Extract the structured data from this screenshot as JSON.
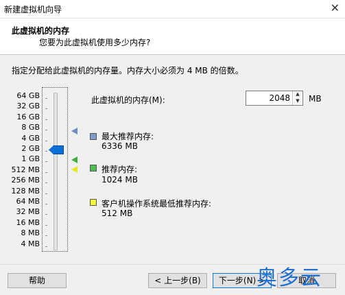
{
  "window": {
    "title": "新建虚拟机向导",
    "close_glyph": "✕"
  },
  "header": {
    "title": "此虚拟机的内存",
    "subtitle": "您要为此虚拟机使用多少内存?"
  },
  "instruction": "指定分配给此虚拟机的内存量。内存大小必须为 4 MB 的倍数。",
  "memory": {
    "label": "此虚拟机的内存(M):",
    "value": "2048",
    "unit": "MB",
    "up_glyph": "▲",
    "down_glyph": "▼"
  },
  "scale": [
    "64 GB",
    "32 GB",
    "16 GB",
    "8 GB",
    "4 GB",
    "2 GB",
    "1 GB",
    "512 MB",
    "256 MB",
    "128 MB",
    "64 MB",
    "32 MB",
    "16 MB",
    "8 MB",
    "4 MB"
  ],
  "recommendations": {
    "max": {
      "label": "最大推荐内存:",
      "value": "6336 MB",
      "color": "#7e9cc8"
    },
    "recommended": {
      "label": "推荐内存:",
      "value": "1024 MB",
      "color": "#4cc04c"
    },
    "guest_min": {
      "label": "客户机操作系统最低推荐内存:",
      "value": "512 MB",
      "color": "#f7f734"
    }
  },
  "buttons": {
    "help": "帮助",
    "back": "< 上一步(B)",
    "next": "下一步(N) >",
    "cancel": "取消"
  },
  "watermark": "奥多云"
}
